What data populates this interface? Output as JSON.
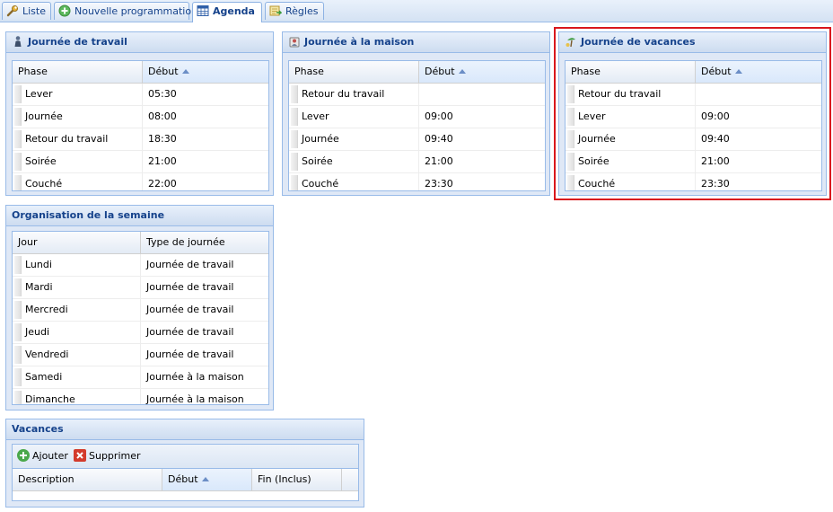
{
  "tabs": [
    {
      "label": "Liste",
      "icon": "wrench-icon"
    },
    {
      "label": "Nouvelle programmation",
      "icon": "add-circle-icon"
    },
    {
      "label": "Agenda",
      "icon": "calendar-grid-icon",
      "active": true
    },
    {
      "label": "Règles",
      "icon": "rules-icon"
    }
  ],
  "panels": {
    "travail": {
      "title": "Journée de travail",
      "columns": [
        "Phase",
        "Début"
      ],
      "rows": [
        [
          "Lever",
          "05:30"
        ],
        [
          "Journée",
          "08:00"
        ],
        [
          "Retour du travail",
          "18:30"
        ],
        [
          "Soirée",
          "21:00"
        ],
        [
          "Couché",
          "22:00"
        ]
      ]
    },
    "maison": {
      "title": "Journée à la maison",
      "columns": [
        "Phase",
        "Début"
      ],
      "rows": [
        [
          "Retour du travail",
          ""
        ],
        [
          "Lever",
          "09:00"
        ],
        [
          "Journée",
          "09:40"
        ],
        [
          "Soirée",
          "21:00"
        ],
        [
          "Couché",
          "23:30"
        ]
      ]
    },
    "vacances_jour": {
      "title": "Journée de vacances",
      "columns": [
        "Phase",
        "Début"
      ],
      "rows": [
        [
          "Retour du travail",
          ""
        ],
        [
          "Lever",
          "09:00"
        ],
        [
          "Journée",
          "09:40"
        ],
        [
          "Soirée",
          "21:00"
        ],
        [
          "Couché",
          "23:30"
        ]
      ]
    },
    "semaine": {
      "title": "Organisation de la semaine",
      "columns": [
        "Jour",
        "Type de journée"
      ],
      "rows": [
        [
          "Lundi",
          "Journée de travail"
        ],
        [
          "Mardi",
          "Journée de travail"
        ],
        [
          "Mercredi",
          "Journée de travail"
        ],
        [
          "Jeudi",
          "Journée de travail"
        ],
        [
          "Vendredi",
          "Journée de travail"
        ],
        [
          "Samedi",
          "Journée à la maison"
        ],
        [
          "Dimanche",
          "Journée à la maison"
        ]
      ]
    },
    "vacances": {
      "title": "Vacances",
      "add_label": "Ajouter",
      "delete_label": "Supprimer",
      "columns": [
        "Description",
        "Début",
        "Fin (Inclus)"
      ]
    }
  },
  "colors": {
    "accent": "#15428b",
    "border": "#99bbe8",
    "highlight": "#d9171d"
  }
}
